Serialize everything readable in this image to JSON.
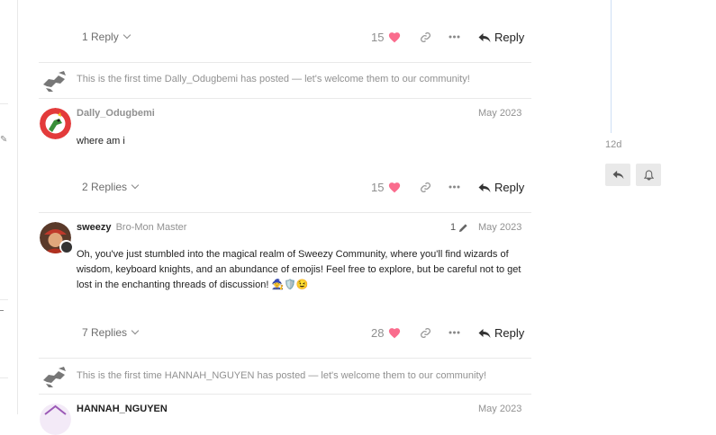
{
  "posts": [
    {
      "replies_label": "1 Reply",
      "likes": "15",
      "reply_label": "Reply"
    },
    {
      "welcome_text": "This is the first time Dally_Odugbemi has posted — let's welcome them to our community!",
      "username": "Dally_Odugbemi",
      "date": "May 2023",
      "body": "where am i",
      "replies_label": "2 Replies",
      "likes": "15",
      "reply_label": "Reply"
    },
    {
      "username": "sweezy",
      "title": "Bro-Mon Master",
      "edit_count": "1",
      "date": "May 2023",
      "body": "Oh, you've just stumbled into the magical realm of Sweezy Community, where you'll find wizards of wisdom, keyboard knights, and an abundance of emojis! Feel free to explore, but be careful not to get lost in the enchanting threads of discussion!",
      "emojis": "🧙🛡️😉",
      "replies_label": "7 Replies",
      "likes": "28",
      "reply_label": "Reply"
    },
    {
      "welcome_text": "This is the first time HANNAH_NGUYEN has posted — let's welcome them to our community!",
      "username": "HANNAH_NGUYEN",
      "date": "May 2023"
    }
  ],
  "timeline": {
    "age": "12d"
  },
  "colors": {
    "heart": "#fa6c8d",
    "timeline": "#cfe0f5"
  },
  "icons": [
    "heart-icon",
    "link-icon",
    "more-icon",
    "reply-arrow-icon",
    "hand-wave-icon",
    "pencil-icon",
    "bell-icon"
  ]
}
